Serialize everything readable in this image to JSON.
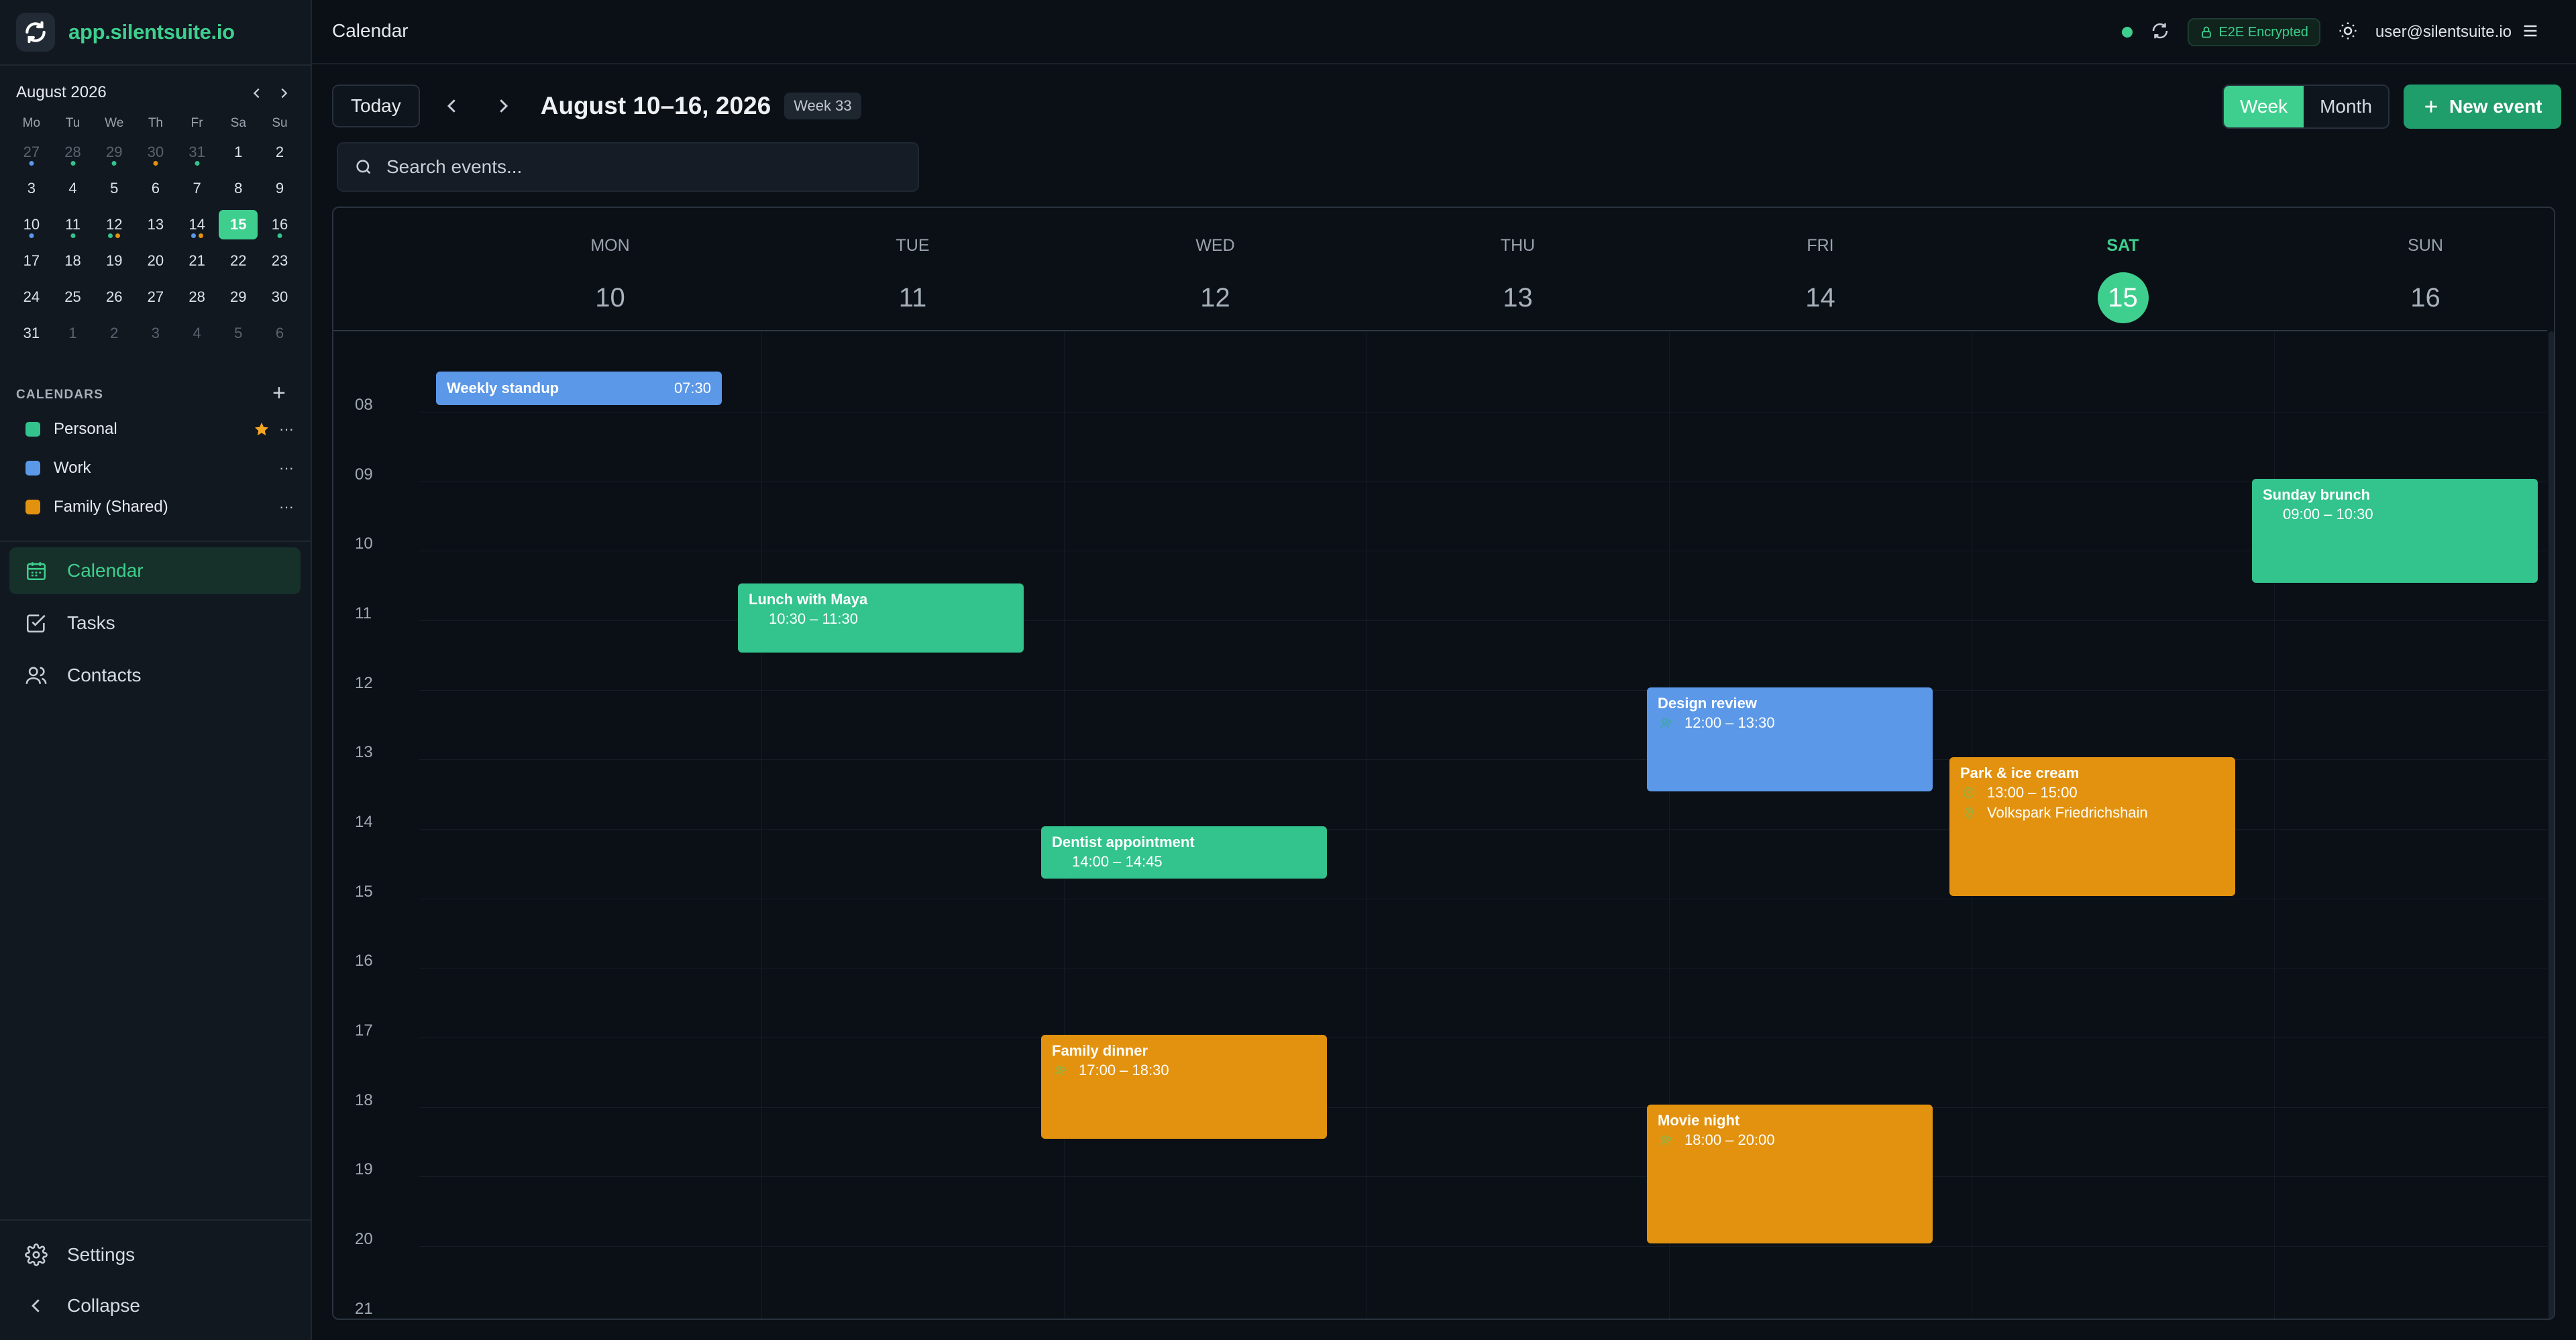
{
  "app": {
    "name": "app.silentsuite.io"
  },
  "topbar": {
    "title": "Calendar",
    "encryption": "E2E Encrypted",
    "user": "user@silentsuite.io"
  },
  "mini_calendar": {
    "title": "August 2026",
    "weekdays": [
      "Mo",
      "Tu",
      "We",
      "Th",
      "Fr",
      "Sa",
      "Su"
    ],
    "weeks": [
      [
        "27",
        "28",
        "29",
        "30",
        "31",
        "1",
        "2"
      ],
      [
        "3",
        "4",
        "5",
        "6",
        "7",
        "8",
        "9"
      ],
      [
        "10",
        "11",
        "12",
        "13",
        "14",
        "15",
        "16"
      ],
      [
        "17",
        "18",
        "19",
        "20",
        "21",
        "22",
        "23"
      ],
      [
        "24",
        "25",
        "26",
        "27",
        "28",
        "29",
        "30"
      ],
      [
        "31",
        "1",
        "2",
        "3",
        "4",
        "5",
        "6"
      ]
    ]
  },
  "calendars": {
    "header": "CALENDARS",
    "items": [
      {
        "label": "Personal",
        "color": "#33c38d"
      },
      {
        "label": "Work",
        "color": "#5b98e8"
      },
      {
        "label": "Family (Shared)",
        "color": "#e2920e"
      }
    ]
  },
  "nav": {
    "calendar": "Calendar",
    "tasks": "Tasks",
    "contacts": "Contacts",
    "settings": "Settings",
    "collapse": "Collapse"
  },
  "toolbar": {
    "today": "Today",
    "range": "August 10–16, 2026",
    "week_badge": "Week 33",
    "view_week": "Week",
    "view_month": "Month",
    "new_event": "New event"
  },
  "search": {
    "placeholder": "Search events..."
  },
  "week": {
    "days": [
      {
        "name": "MON",
        "num": "10"
      },
      {
        "name": "TUE",
        "num": "11"
      },
      {
        "name": "WED",
        "num": "12"
      },
      {
        "name": "THU",
        "num": "13"
      },
      {
        "name": "FRI",
        "num": "14"
      },
      {
        "name": "SAT",
        "num": "15"
      },
      {
        "name": "SUN",
        "num": "16"
      }
    ],
    "hours": [
      "08",
      "09",
      "10",
      "11",
      "12",
      "13",
      "14",
      "15",
      "16",
      "17",
      "18",
      "19",
      "20",
      "21"
    ]
  },
  "events": {
    "standup": {
      "title": "Weekly standup",
      "time": "07:30"
    },
    "lunch": {
      "title": "Lunch with Maya",
      "time": "10:30 – 11:30"
    },
    "dentist": {
      "title": "Dentist appointment",
      "time": "14:00 – 14:45"
    },
    "family_dinner": {
      "title": "Family dinner",
      "time": "17:00 – 18:30"
    },
    "design_review": {
      "title": "Design review",
      "time": "12:00 – 13:30"
    },
    "movie": {
      "title": "Movie night",
      "time": "18:00 – 20:00"
    },
    "park": {
      "title": "Park & ice cream",
      "time": "13:00 – 15:00",
      "location": "Volkspark Friedrichshain"
    },
    "brunch": {
      "title": "Sunday brunch",
      "time": "09:00 – 10:30"
    }
  }
}
